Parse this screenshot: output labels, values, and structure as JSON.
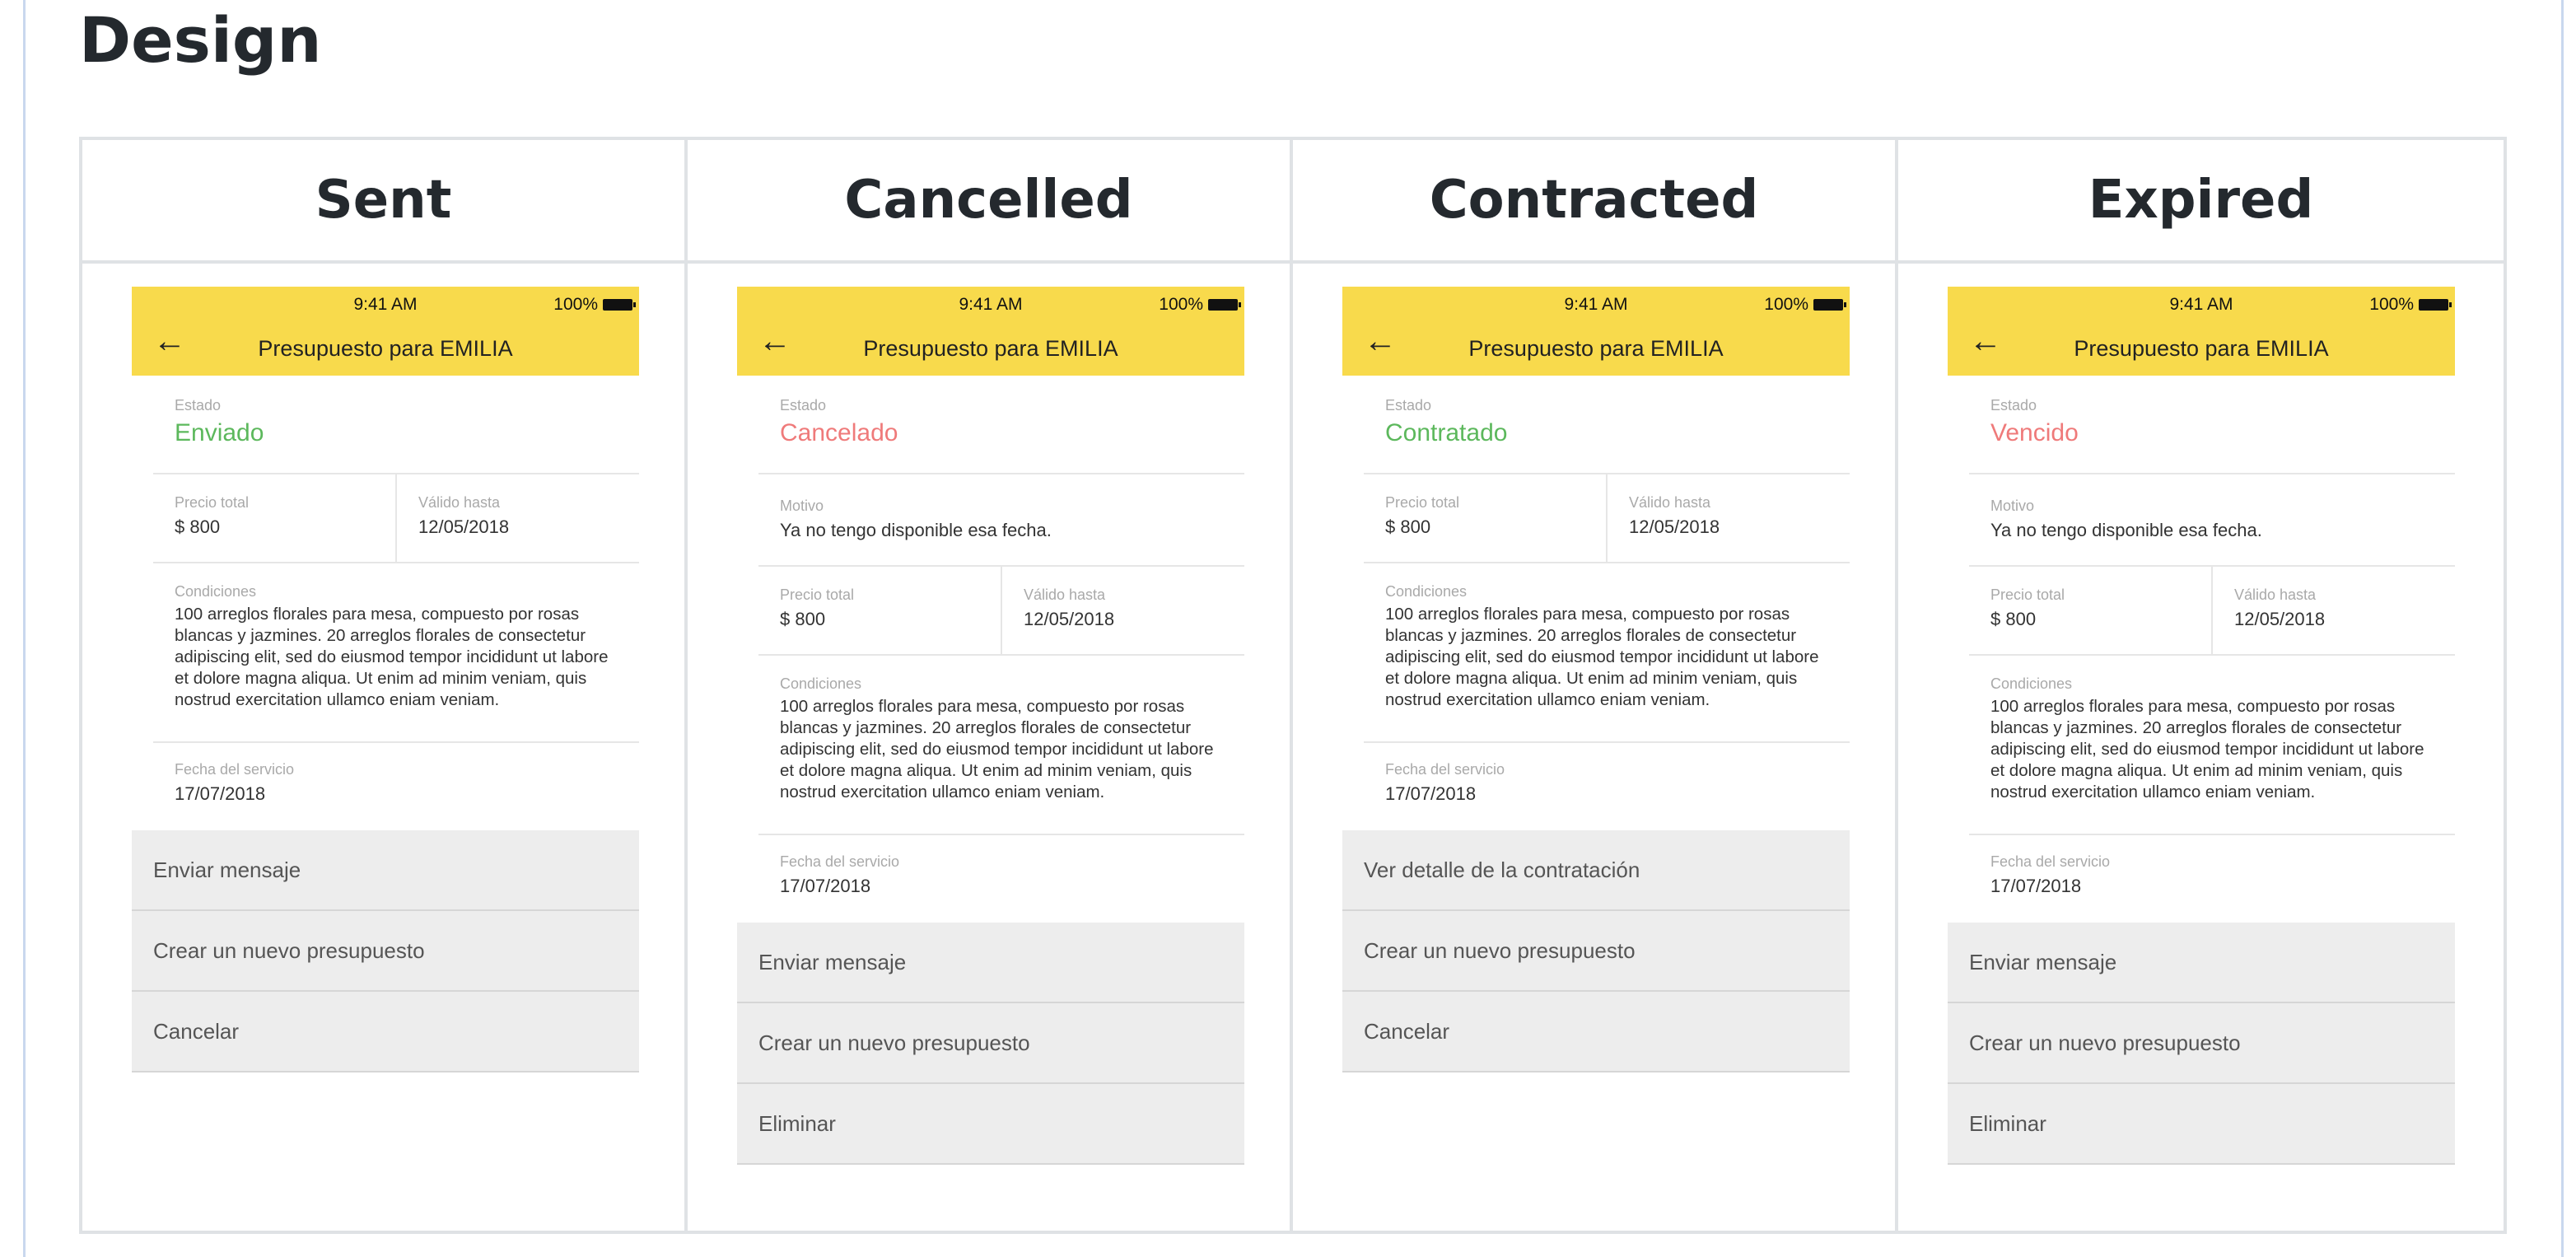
{
  "page": {
    "title": "Design"
  },
  "columns": [
    {
      "heading": "Sent"
    },
    {
      "heading": "Cancelled"
    },
    {
      "heading": "Contracted"
    },
    {
      "heading": "Expired"
    }
  ],
  "common": {
    "time": "9:41 AM",
    "battery": "100%",
    "nav_title": "Presupuesto para EMILIA",
    "back_glyph": "←",
    "estado_label": "Estado",
    "motivo_label": "Motivo",
    "precio_label": "Precio total",
    "valido_label": "Válido hasta",
    "condiciones_label": "Condiciones",
    "fecha_label": "Fecha del servicio"
  },
  "screens": [
    {
      "state": "Enviado",
      "state_color": "#5cb85c",
      "precio": "$ 800",
      "valido": "12/05/2018",
      "condiciones": "100 arreglos florales para mesa, compuesto por rosas blancas y jazmines. 20 arreglos florales de consectetur adipiscing elit, sed do eiusmod tempor incididunt ut labore et dolore magna aliqua. Ut enim ad minim veniam, quis nostrud exercitation ullamco eniam veniam.",
      "fecha": "17/07/2018",
      "actions": [
        "Enviar mensaje",
        "Crear un nuevo presupuesto",
        "Cancelar"
      ]
    },
    {
      "state": "Cancelado",
      "state_color": "#ef7a7a",
      "motivo": "Ya no tengo disponible esa fecha.",
      "precio": "$ 800",
      "valido": "12/05/2018",
      "condiciones": "100 arreglos florales para mesa, compuesto por rosas blancas y jazmines. 20 arreglos florales de consectetur adipiscing elit, sed do eiusmod tempor incididunt ut labore et dolore magna aliqua. Ut enim ad minim veniam, quis nostrud exercitation ullamco eniam veniam.",
      "fecha": "17/07/2018",
      "actions": [
        "Enviar mensaje",
        "Crear un nuevo presupuesto",
        "Eliminar"
      ]
    },
    {
      "state": "Contratado",
      "state_color": "#5cb85c",
      "precio": "$ 800",
      "valido": "12/05/2018",
      "condiciones": "100 arreglos florales para mesa, compuesto por rosas blancas y jazmines. 20 arreglos florales de consectetur adipiscing elit, sed do eiusmod tempor incididunt ut labore et dolore magna aliqua. Ut enim ad minim veniam, quis nostrud exercitation ullamco eniam veniam.",
      "fecha": "17/07/2018",
      "actions": [
        "Ver detalle de la contratación",
        "Crear un nuevo presupuesto",
        "Cancelar"
      ]
    },
    {
      "state": "Vencido",
      "state_color": "#ef7a7a",
      "motivo": "Ya no tengo disponible esa fecha.",
      "precio": "$ 800",
      "valido": "12/05/2018",
      "condiciones": "100 arreglos florales para mesa, compuesto por rosas blancas y jazmines. 20 arreglos florales de consectetur adipiscing elit, sed do eiusmod tempor incididunt ut labore et dolore magna aliqua. Ut enim ad minim veniam, quis nostrud exercitation ullamco eniam veniam.",
      "fecha": "17/07/2018",
      "actions": [
        "Enviar mensaje",
        "Crear un nuevo presupuesto",
        "Eliminar"
      ]
    }
  ]
}
